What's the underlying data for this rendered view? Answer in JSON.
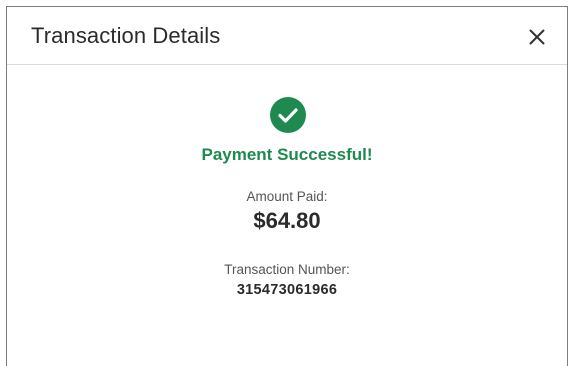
{
  "dialog": {
    "title": "Transaction Details",
    "close_icon": "close-icon"
  },
  "status": {
    "icon": "check-circle-icon",
    "message": "Payment Successful!",
    "color": "#1f8a50"
  },
  "amount": {
    "label": "Amount Paid:",
    "value": "$64.80"
  },
  "transaction": {
    "label": "Transaction Number:",
    "value": "315473061966"
  }
}
